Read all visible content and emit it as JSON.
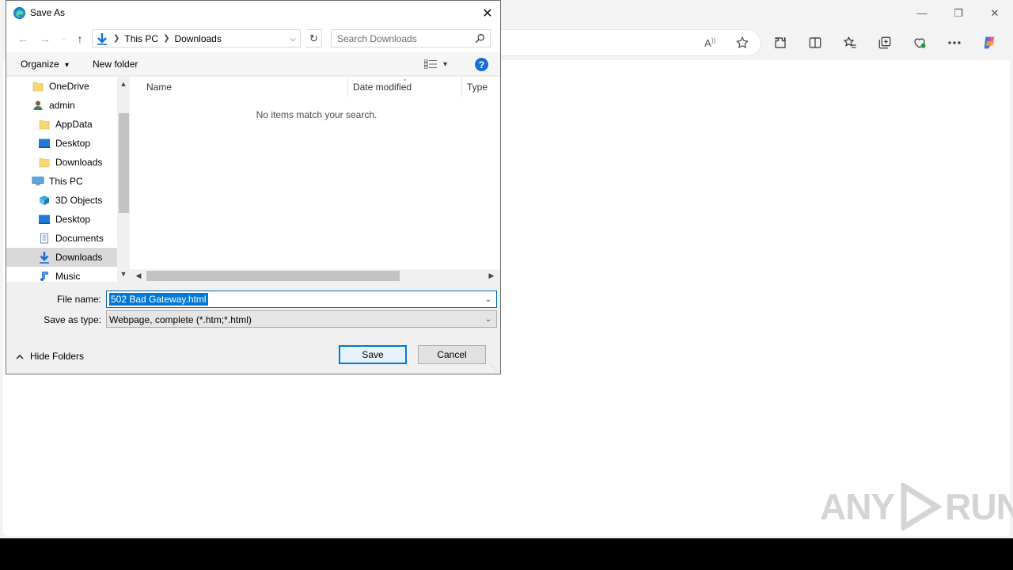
{
  "browser": {
    "window_controls": {
      "minimize": "—",
      "restore": "❐",
      "close": "✕"
    },
    "toolbar_icons": [
      "read-aloud-icon",
      "favorite-star-icon",
      "extensions-icon",
      "split-screen-icon",
      "favorites-icon",
      "collections-icon",
      "browser-essentials-icon",
      "more-icon",
      "copilot-icon"
    ]
  },
  "watermark": {
    "text_left": "ANY",
    "text_right": "RUN"
  },
  "dialog": {
    "title": "Save As",
    "close": "✕",
    "breadcrumb": [
      "This PC",
      "Downloads"
    ],
    "search_placeholder": "Search Downloads",
    "commands": {
      "organize": "Organize",
      "organize_arrow": "▾",
      "new_folder": "New folder",
      "view_arrow": "▾",
      "help": "?"
    },
    "tree": [
      {
        "label": "OneDrive",
        "icon": "folder-icon",
        "indent": 0,
        "selected": false
      },
      {
        "label": "admin",
        "icon": "user-icon",
        "indent": 0,
        "selected": false
      },
      {
        "label": "AppData",
        "icon": "folder-icon",
        "indent": 1,
        "selected": false
      },
      {
        "label": "Desktop",
        "icon": "desktop-icon",
        "indent": 1,
        "selected": false
      },
      {
        "label": "Downloads",
        "icon": "folder-icon",
        "indent": 1,
        "selected": false
      },
      {
        "label": "This PC",
        "icon": "computer-icon",
        "indent": 0,
        "selected": false
      },
      {
        "label": "3D Objects",
        "icon": "3d-objects-icon",
        "indent": 1,
        "selected": false
      },
      {
        "label": "Desktop",
        "icon": "desktop-icon",
        "indent": 1,
        "selected": false
      },
      {
        "label": "Documents",
        "icon": "documents-icon",
        "indent": 1,
        "selected": false
      },
      {
        "label": "Downloads",
        "icon": "download-arrow-icon",
        "indent": 1,
        "selected": true
      },
      {
        "label": "Music",
        "icon": "music-icon",
        "indent": 1,
        "selected": false
      }
    ],
    "columns": [
      "Name",
      "Date modified",
      "Type"
    ],
    "empty_message": "No items match your search.",
    "file_name_label": "File name:",
    "file_name_value": "502 Bad Gateway.html",
    "save_type_label": "Save as type:",
    "save_type_value": "Webpage, complete (*.htm;*.html)",
    "hide_folders": "Hide Folders",
    "save_button": "Save",
    "cancel_button": "Cancel"
  }
}
